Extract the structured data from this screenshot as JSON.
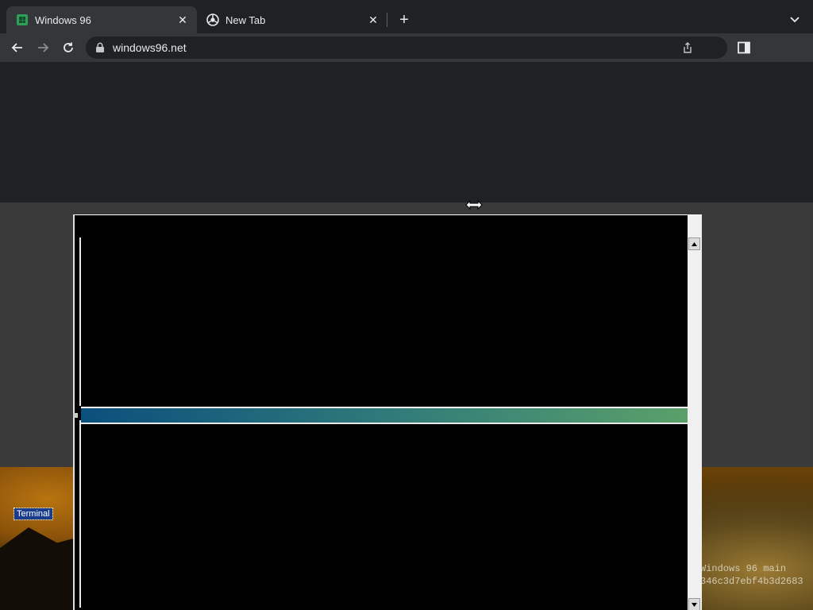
{
  "browser": {
    "tabs": [
      {
        "title": "Windows 96",
        "active": true,
        "favicon": "windows96-logo-icon"
      },
      {
        "title": "New Tab",
        "active": false,
        "favicon": "chrome-icon"
      }
    ],
    "address": "windows96.net"
  },
  "desktop": {
    "icon_label": "Terminal",
    "watermark_line1": "Windows 96 main",
    "watermark_line2": "346c3d7ebf4b3d2683"
  },
  "colors": {
    "chrome_dark": "#202124",
    "chrome_toolbar": "#35363a",
    "titlebar_start": "#0b4f7d",
    "titlebar_end": "#5aa06a"
  }
}
